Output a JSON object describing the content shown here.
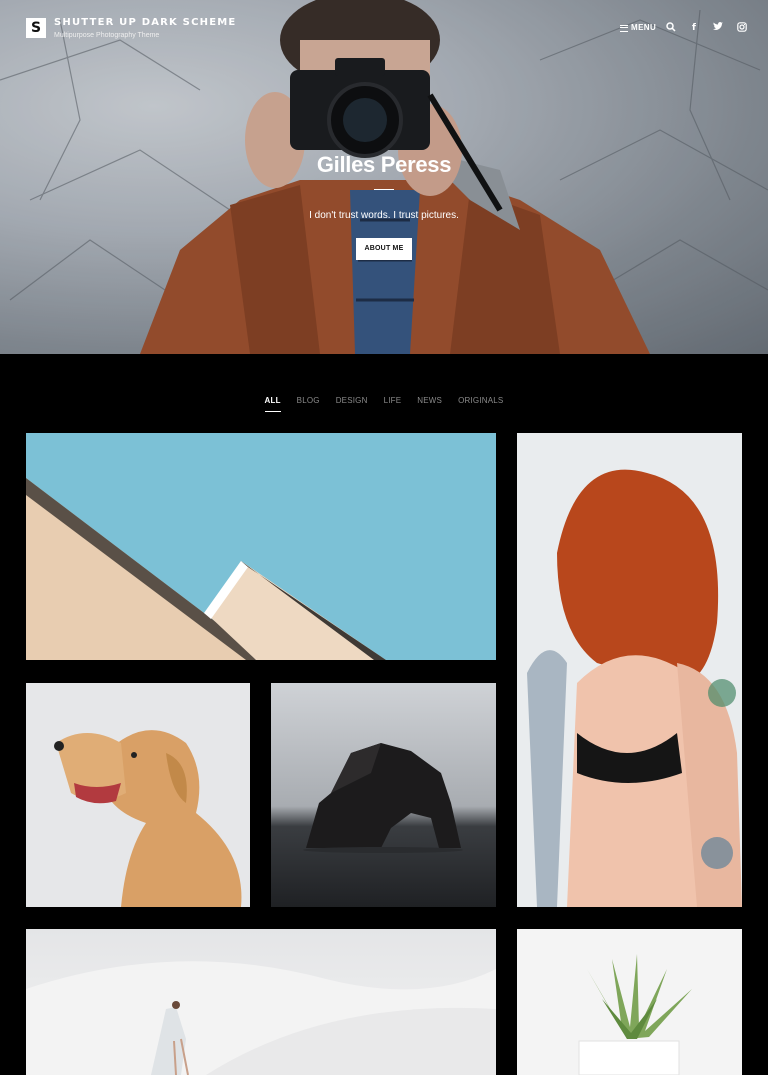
{
  "header": {
    "logo_letter": "S",
    "site_title": "SHUTTER UP DARK SCHEME",
    "site_tagline": "Multipurpose Photography Theme",
    "menu_label": "MENU",
    "icons": [
      "search-icon",
      "facebook-icon",
      "twitter-icon",
      "instagram-icon"
    ]
  },
  "hero": {
    "title": "Gilles Peress",
    "tagline": "I don't trust words. I trust pictures.",
    "button_label": "ABOUT ME"
  },
  "filters": {
    "items": [
      "ALL",
      "BLOG",
      "DESIGN",
      "LIFE",
      "NEWS",
      "ORIGINALS"
    ],
    "active": "ALL"
  },
  "gallery": {
    "tiles": [
      "architecture-sky-photo",
      "red-haired-woman-photo",
      "golden-retriever-photo",
      "sea-rock-arch-photo",
      "desert-dunes-woman-photo",
      "potted-succulent-photo"
    ]
  },
  "colors": {
    "background": "#000000",
    "accent": "#ffffff",
    "muted_text": "#8a8a8a"
  }
}
